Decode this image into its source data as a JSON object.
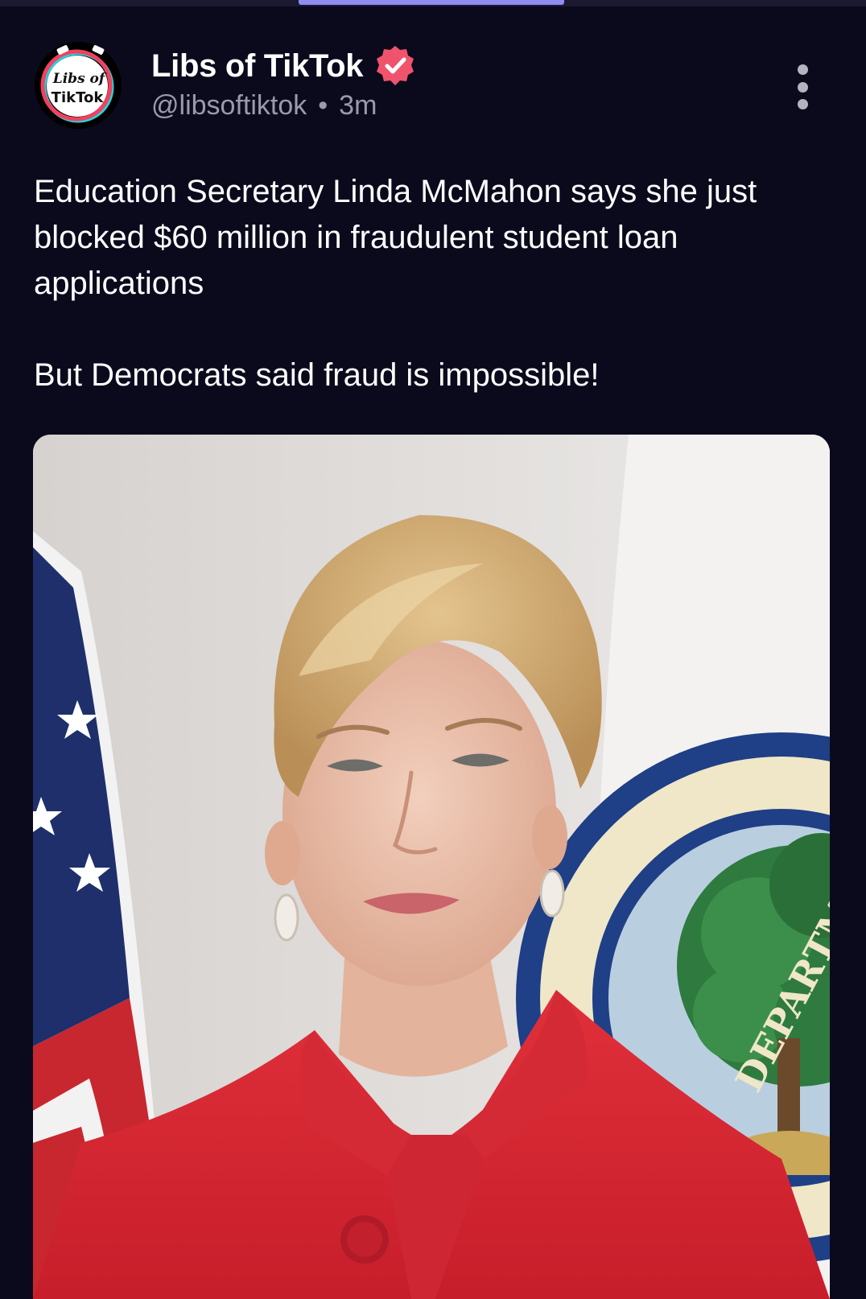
{
  "post": {
    "author": {
      "display_name": "Libs of TikTok",
      "handle": "@libsoftiktok",
      "avatar_text_line1": "Libs of",
      "avatar_text_line2": "TikTok",
      "verified_icon": "verified-badge-icon"
    },
    "separator": "•",
    "timestamp": "3m",
    "more_icon": "more-vertical-icon",
    "text": {
      "paragraph1": "Education Secretary Linda McMahon says she just blocked $60 million in fraudulent student loan applications",
      "paragraph2": "But Democrats said fraud is impossible!"
    },
    "media": {
      "seal_text": "DEPARTMENT"
    }
  },
  "colors": {
    "background": "#0b0a1d",
    "accent_indicator": "#8f8cf2",
    "verified_badge": "#f0546c",
    "meta_text": "#9b9aaa"
  }
}
